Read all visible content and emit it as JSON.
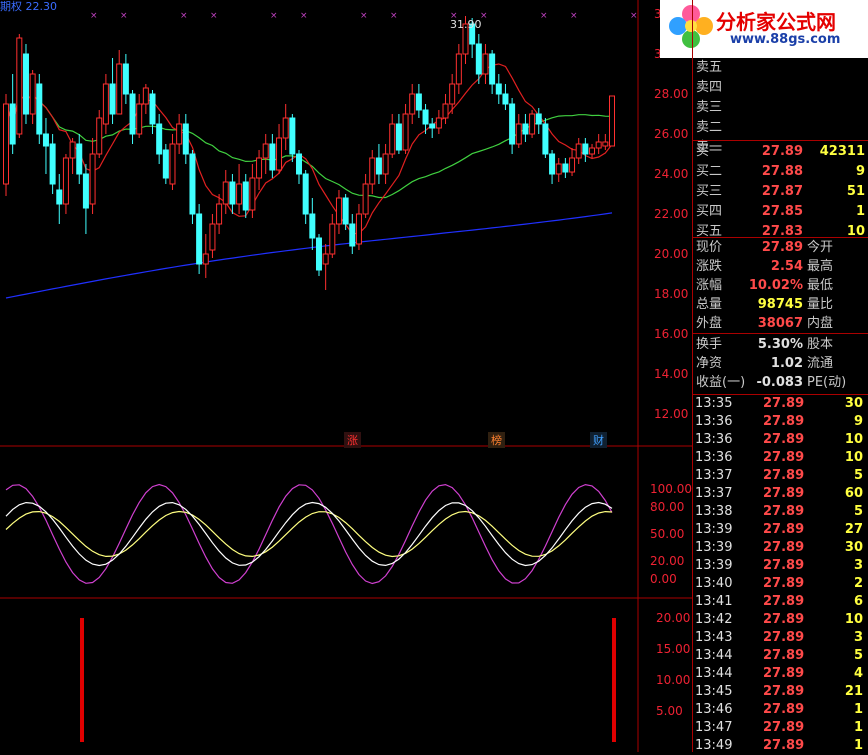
{
  "header": {
    "indicator_label": "期权 22.30",
    "max_price_label": "31.90"
  },
  "logo": {
    "title": "分析家公式网",
    "url": "www.88gs.com"
  },
  "price_axis": [
    "3",
    "30.00",
    "28.00",
    "26.00",
    "24.00",
    "22.00",
    "20.00",
    "18.00",
    "16.00",
    "14.00",
    "12.00"
  ],
  "kdj_axis": [
    "100.00",
    "80.00",
    "50.00",
    "20.00",
    "0.00"
  ],
  "vol_axis": [
    "20.00",
    "15.00",
    "10.00",
    "5.00"
  ],
  "markers": [
    {
      "label": "涨",
      "color": "#ff3030"
    },
    {
      "label": "榜",
      "color": "#ff8030"
    },
    {
      "label": "财",
      "color": "#40a0ff"
    }
  ],
  "asks": [
    {
      "label": "卖五"
    },
    {
      "label": "卖四"
    },
    {
      "label": "卖三"
    },
    {
      "label": "卖二"
    },
    {
      "label": "卖一"
    }
  ],
  "bids": [
    {
      "label": "买一",
      "price": "27.89",
      "vol": "42311"
    },
    {
      "label": "买二",
      "price": "27.88",
      "vol": "9"
    },
    {
      "label": "买三",
      "price": "27.87",
      "vol": "51"
    },
    {
      "label": "买四",
      "price": "27.85",
      "vol": "1"
    },
    {
      "label": "买五",
      "price": "27.83",
      "vol": "10"
    }
  ],
  "stats": [
    {
      "label": "现价",
      "value": "27.89",
      "label2": "今开",
      "color": "#ff4a4a"
    },
    {
      "label": "涨跌",
      "value": "2.54",
      "label2": "最高",
      "color": "#ff4a4a"
    },
    {
      "label": "涨幅",
      "value": "10.02%",
      "label2": "最低",
      "color": "#ff4a4a"
    },
    {
      "label": "总量",
      "value": "98745",
      "label2": "量比",
      "color": "#ffff40"
    },
    {
      "label": "外盘",
      "value": "38067",
      "label2": "内盘",
      "color": "#ff4a4a"
    },
    {
      "label": "换手",
      "value": "5.30%",
      "label2": "股本",
      "color": "#e0e0e0"
    },
    {
      "label": "净资",
      "value": "1.02",
      "label2": "流通",
      "color": "#e0e0e0"
    },
    {
      "label": "收益(一)",
      "value": "-0.083",
      "label2": "PE(动)",
      "color": "#e0e0e0"
    }
  ],
  "ticks": [
    {
      "time": "13:35",
      "price": "27.89",
      "vol": "30"
    },
    {
      "time": "13:36",
      "price": "27.89",
      "vol": "9"
    },
    {
      "time": "13:36",
      "price": "27.89",
      "vol": "10"
    },
    {
      "time": "13:36",
      "price": "27.89",
      "vol": "10"
    },
    {
      "time": "13:37",
      "price": "27.89",
      "vol": "5"
    },
    {
      "time": "13:37",
      "price": "27.89",
      "vol": "60"
    },
    {
      "time": "13:38",
      "price": "27.89",
      "vol": "5"
    },
    {
      "time": "13:39",
      "price": "27.89",
      "vol": "27"
    },
    {
      "time": "13:39",
      "price": "27.89",
      "vol": "30"
    },
    {
      "time": "13:39",
      "price": "27.89",
      "vol": "3"
    },
    {
      "time": "13:40",
      "price": "27.89",
      "vol": "2"
    },
    {
      "time": "13:41",
      "price": "27.89",
      "vol": "6"
    },
    {
      "time": "13:42",
      "price": "27.89",
      "vol": "10"
    },
    {
      "time": "13:43",
      "price": "27.89",
      "vol": "3"
    },
    {
      "time": "13:44",
      "price": "27.89",
      "vol": "5"
    },
    {
      "time": "13:44",
      "price": "27.89",
      "vol": "4"
    },
    {
      "time": "13:45",
      "price": "27.89",
      "vol": "21"
    },
    {
      "time": "13:46",
      "price": "27.89",
      "vol": "1"
    },
    {
      "time": "13:47",
      "price": "27.89",
      "vol": "1"
    },
    {
      "time": "13:49",
      "price": "27.89",
      "vol": "1"
    }
  ],
  "colors": {
    "up": "#ff3030",
    "down": "#40ffff",
    "ma_short": "#e02020",
    "ma_mid": "#40d040",
    "ma_long": "#2030ff",
    "k": "#ffffff",
    "d": "#ffff80",
    "j": "#d040d0"
  }
}
